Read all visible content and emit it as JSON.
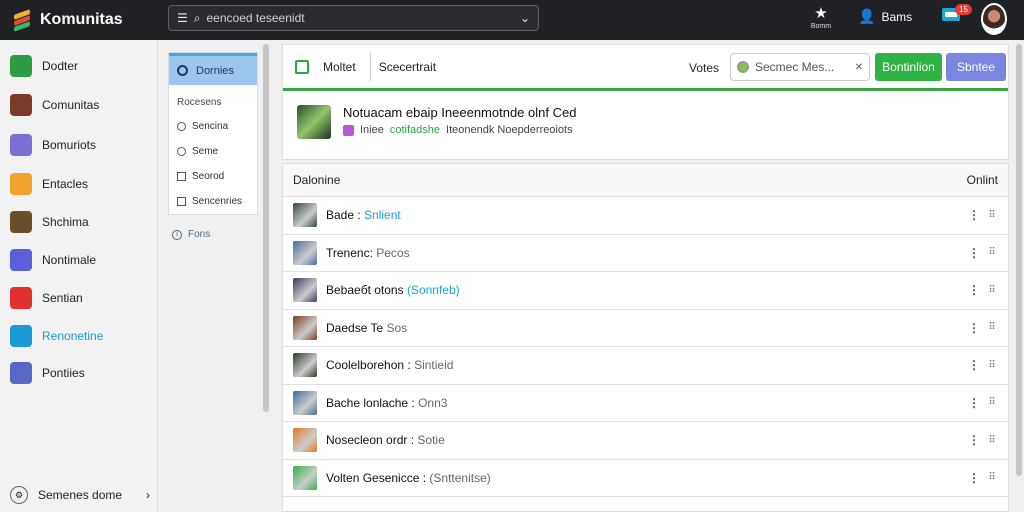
{
  "app": {
    "title": "Komunitas",
    "search_text": "eencoed teseenidt"
  },
  "topbar": {
    "star_label": "Bomm",
    "user_label": "Bams",
    "badge_count": "15"
  },
  "sidebar": {
    "items": [
      {
        "label": "Dodter",
        "icon": "home-icon",
        "color": "#2e9b45"
      },
      {
        "label": "Comunitas",
        "icon": "game-avatar-icon",
        "color": "#7a3b2a"
      },
      {
        "label": "Bomuriots",
        "icon": "flag-icon",
        "color": "#7a6fd6"
      },
      {
        "label": "Entacles",
        "icon": "download-icon",
        "color": "#f0a22c"
      },
      {
        "label": "Shchima",
        "icon": "game-avatar-icon",
        "color": "#6b4f2a"
      },
      {
        "label": "Nontimale",
        "icon": "puzzle-icon",
        "color": "#5b5fd9"
      },
      {
        "label": "Sentian",
        "icon": "flag-icon",
        "color": "#e03030"
      },
      {
        "label": "Renonetine",
        "icon": "share-icon",
        "color": "#1a9ad6"
      },
      {
        "label": "Pontiies",
        "icon": "z-icon",
        "color": "#5967c9"
      }
    ],
    "footer": "Semenes dome"
  },
  "filters": {
    "header": "Dornies",
    "title": "Rocesens",
    "options": [
      {
        "label": "Sencina",
        "type": "radio"
      },
      {
        "label": "Seme",
        "type": "radio"
      },
      {
        "label": "Seorod",
        "type": "check"
      },
      {
        "label": "Sencenries",
        "type": "check"
      }
    ],
    "extra": "Fons"
  },
  "card": {
    "tab1": "Moltet",
    "tab2": "Scecertrait",
    "votes": "Votes",
    "filter_placeholder": "Secmeс Mes...",
    "green_button": "Bontinlion",
    "purple_button": "Sbntee",
    "notice_title": "Notuacam ebaip Ineeenmotnde olnf Ced",
    "notice_sub_a": "Iniee",
    "notice_sub_green": "cotifadshe",
    "notice_sub_b": "Iteonendk Noepderreoiots"
  },
  "list": {
    "head_left": "Dalonine",
    "head_right": "Onlint",
    "rows": [
      {
        "name": "Bade : ",
        "status": "Snlient",
        "status_style": "hl",
        "pic": "#2f4a3d"
      },
      {
        "name": "Trenenc: ",
        "status": "Pecos",
        "status_style": "mute",
        "pic": "#4a6b9e"
      },
      {
        "name": "Bebaeбt otons ",
        "status": "(Sonnfeb)",
        "status_style": "hl",
        "pic": "#3a3b5a"
      },
      {
        "name": "Daedse Te ",
        "status": "Sos",
        "status_style": "mute",
        "pic": "#7a3e22"
      },
      {
        "name": "Coolelborehon : ",
        "status": "Sintieid",
        "status_style": "mute",
        "pic": "#2d3a2a"
      },
      {
        "name": "Bache lonlache : ",
        "status": "Onn3",
        "status_style": "mute",
        "pic": "#3b6fa0"
      },
      {
        "name": "Nosecleon ordr : ",
        "status": "Sotie",
        "status_style": "mute",
        "pic": "#e07b20"
      },
      {
        "name": "Volten Gesenicce : ",
        "status": "(Snttenitse)",
        "status_style": "mute",
        "pic": "#2fb344"
      }
    ]
  }
}
